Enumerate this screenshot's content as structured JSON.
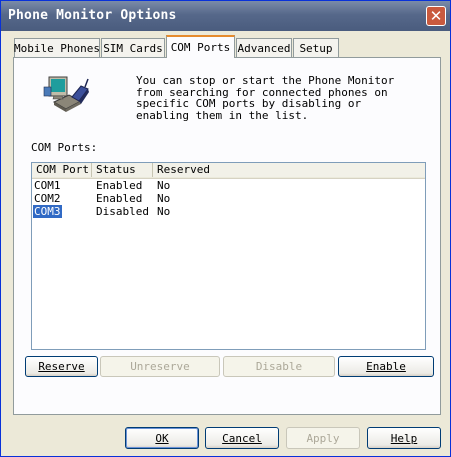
{
  "window": {
    "title": "Phone Monitor Options",
    "close_glyph": "✕"
  },
  "tabs": [
    {
      "label": "Mobile Phones",
      "active": false
    },
    {
      "label": "SIM Cards",
      "active": false
    },
    {
      "label": "COM Ports",
      "active": true
    },
    {
      "label": "Advanced",
      "active": false
    },
    {
      "label": "Setup",
      "active": false
    }
  ],
  "panel": {
    "icon": "phone-monitor-icon",
    "description": "You can stop or start the Phone Monitor\nfrom searching for connected phones on\nspecific COM ports by disabling or\nenabling them in the list.",
    "ports_label": "COM Ports:"
  },
  "list": {
    "columns": [
      "COM Port",
      "Status",
      "Reserved"
    ],
    "rows": [
      {
        "port": "COM1",
        "status": "Enabled",
        "reserved": "No",
        "selected": false
      },
      {
        "port": "COM2",
        "status": "Enabled",
        "reserved": "No",
        "selected": false
      },
      {
        "port": "COM3",
        "status": "Disabled",
        "reserved": "No",
        "selected": true
      }
    ]
  },
  "port_buttons": [
    {
      "label": "Reserve",
      "enabled": true
    },
    {
      "label": "Unreserve",
      "enabled": false
    },
    {
      "label": "Disable",
      "enabled": false
    },
    {
      "label": "Enable",
      "enabled": true
    }
  ],
  "dialog_buttons": [
    {
      "label": "OK",
      "enabled": true
    },
    {
      "label": "Cancel",
      "enabled": true
    },
    {
      "label": "Apply",
      "enabled": false
    },
    {
      "label": "Help",
      "enabled": true
    }
  ],
  "colors": {
    "selection": "#316ac5",
    "tab_highlight": "#e68b2c",
    "title_bar": "#56688a"
  }
}
